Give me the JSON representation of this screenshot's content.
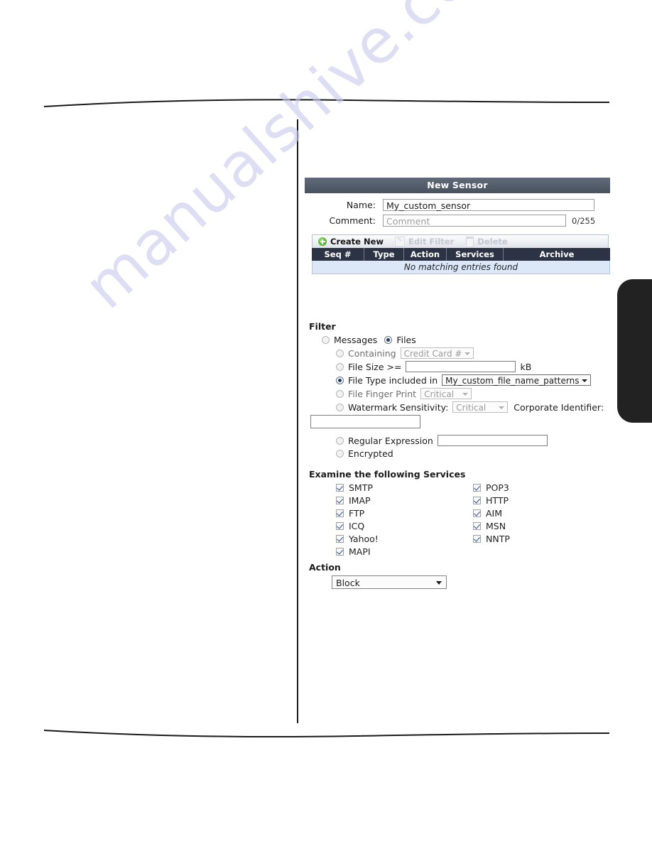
{
  "watermark": {
    "text": "manualshive.com"
  },
  "window": {
    "title": "New Sensor"
  },
  "form": {
    "name_label": "Name:",
    "name_value": "My_custom_sensor",
    "comment_label": "Comment:",
    "comment_placeholder": "Comment",
    "comment_counter": "0/255"
  },
  "toolbar": {
    "create_label": "Create New",
    "edit_label": "Edit Filter",
    "delete_label": "Delete",
    "create_icon": "plus-circle-icon",
    "edit_icon": "pencil-icon",
    "delete_icon": "trash-icon"
  },
  "table": {
    "columns": [
      "Seq #",
      "Type",
      "Action",
      "Services",
      "Archive"
    ],
    "empty_message": "No matching entries found",
    "rows": []
  },
  "filter": {
    "title": "Filter",
    "mode": {
      "messages_label": "Messages",
      "files_label": "Files",
      "selected": "Files"
    },
    "options": [
      {
        "id": "containing",
        "label": "Containing",
        "selected": false,
        "control": "dropdown",
        "value": "Credit Card #",
        "enabled": false
      },
      {
        "id": "file-size",
        "label": "File Size >=",
        "selected": false,
        "control": "text",
        "value": "",
        "suffix": "kB"
      },
      {
        "id": "file-type",
        "label": "File Type included in",
        "selected": true,
        "control": "dropdown",
        "value": "My_custom_file_name_patterns",
        "enabled": true
      },
      {
        "id": "file-finger-print",
        "label": "File Finger Print",
        "selected": false,
        "control": "dropdown",
        "value": "Critical",
        "enabled": false
      },
      {
        "id": "watermark-sensitivity",
        "label": "Watermark Sensitivity:",
        "selected": false,
        "control": "dropdown",
        "value": "Critical",
        "enabled": false,
        "extra_label": "Corporate Identifier:",
        "extra_value": ""
      },
      {
        "id": "regular-expression",
        "label": "Regular Expression",
        "selected": false,
        "control": "text",
        "value": ""
      },
      {
        "id": "encrypted",
        "label": "Encrypted",
        "selected": false,
        "control": "none",
        "value": ""
      }
    ]
  },
  "services": {
    "title": "Examine the following Services",
    "left_column": [
      {
        "label": "SMTP",
        "checked": true
      },
      {
        "label": "IMAP",
        "checked": true
      },
      {
        "label": "FTP",
        "checked": true
      },
      {
        "label": "ICQ",
        "checked": true
      },
      {
        "label": "Yahoo!",
        "checked": true
      },
      {
        "label": "MAPI",
        "checked": true
      }
    ],
    "right_column": [
      {
        "label": "POP3",
        "checked": true
      },
      {
        "label": "HTTP",
        "checked": true
      },
      {
        "label": "AIM",
        "checked": true
      },
      {
        "label": "MSN",
        "checked": true
      },
      {
        "label": "NNTP",
        "checked": true
      }
    ]
  },
  "action": {
    "title": "Action",
    "value": "Block"
  },
  "colors": {
    "titlebar": "#555f6d",
    "table_header": "#2b3344",
    "table_empty_row": "#dce7f7",
    "radio_selected": "#1f3a63",
    "watermark": "#c9c9ee",
    "edge_tab": "#222222"
  }
}
